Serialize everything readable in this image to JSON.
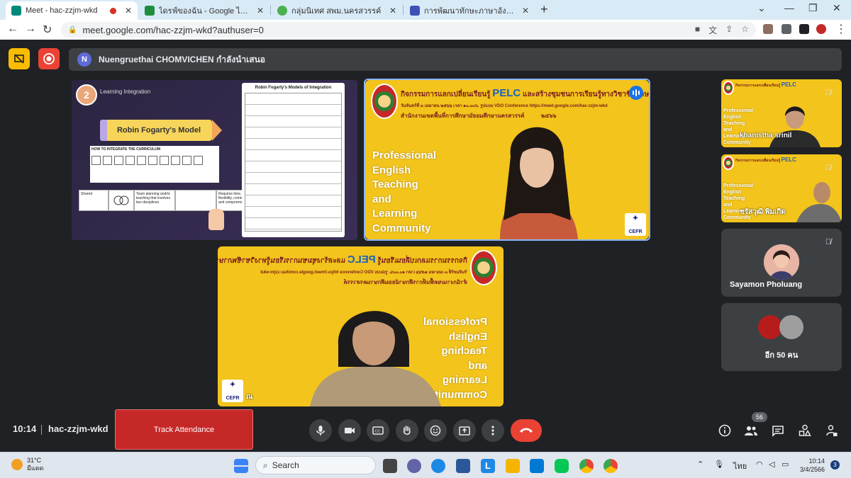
{
  "browser": {
    "tabs": [
      {
        "label": "Meet - hac-zzjm-wkd",
        "favicon_color": "#00897b"
      },
      {
        "label": "ไดรฟ์ของฉัน - Google ไดรฟ์",
        "favicon_color": "#1e8e3e"
      },
      {
        "label": "กลุ่มนิเทศ สพม.นครสวรรค์",
        "favicon_color": "#4caf50"
      },
      {
        "label": "การพัฒนาทักษะภาษาอังกฤษ English",
        "favicon_color": "#3f51b5"
      }
    ],
    "url": "meet.google.com/hac-zzjm-wkd?authuser=0"
  },
  "meet": {
    "presenter_initial": "N",
    "presenter_banner": "Nuengruethai CHOMVICHEN กำลังนำเสนอ",
    "clock": "10:14",
    "meeting_code": "hac-zzjm-wkd",
    "track_attendance": "Track Attendance",
    "participant_count": "56",
    "accent_red": "#ea4335",
    "accent_blue": "#8ab4f8"
  },
  "slide": {
    "badge": "2",
    "heading": "Learning Integration",
    "pencil_label": "Robin Fogarty's Model",
    "howto": "HOW TO INTEGRATE THE CURRICULUM",
    "table_title": "Robin Fogarty's Models of Integration",
    "bottom_left": "Shared",
    "bottom_mid": "Team planning and/or teaching that involves two disciplines",
    "bottom_right": "Requires time, flexibility, commitment and compromise"
  },
  "tiles": {
    "banner_line1": "กิจกรรมการแลกเปลี่ยนเรียนรู้",
    "banner_pelc": "PELC",
    "banner_line1b": "และสร้างชุมชนการเรียนรู้ทางวิชาชีพภาษาอังกฤษ",
    "banner_line2": "วันจันทร์ที่ ๓ เมษายน ๒๕๖๖ เวลา ๑๐.๐๐น. รูปแบบ VDO Conference https://meet.google.com/hac-zzjm-wkd",
    "banner_line3": "สำนักงานเขตพื้นที่การศึกษามัธยมศึกษานครสวรรค์",
    "banner_year": "๒๕๖๖",
    "pet_lines": [
      "Professional",
      "English",
      "Teaching",
      "and",
      "Learning",
      "Community"
    ],
    "cefr": "CEFR",
    "main_name_fragment": "ณ",
    "side1_name": "khanistha srinil",
    "side2_name": "ชรัสวุฒิ พิมเกิด",
    "side3_name": "Sayamon Pholuang",
    "more_label": "อีก 50 คน"
  },
  "taskbar": {
    "temp": "31°C",
    "weather": "มีแดด",
    "search": "Search",
    "lang": "ไทย",
    "time": "10:14",
    "date": "3/4/2566",
    "notif": "3"
  }
}
